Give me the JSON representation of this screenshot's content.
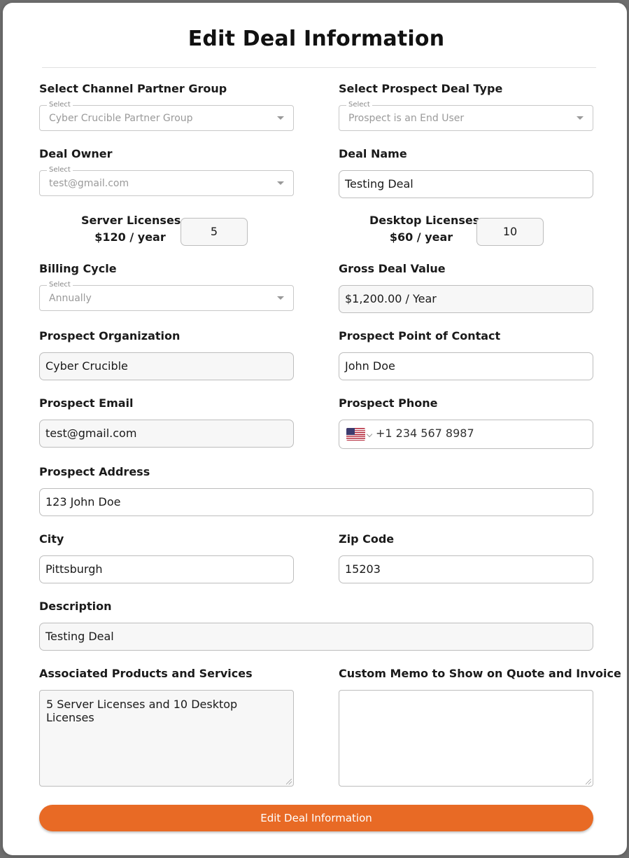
{
  "form": {
    "title": "Edit Deal Information",
    "fields": {
      "channel_partner_group": {
        "label": "Select Channel Partner Group",
        "legend": "Select",
        "value": "Cyber Crucible Partner Group"
      },
      "prospect_deal_type": {
        "label": "Select Prospect Deal Type",
        "legend": "Select",
        "value": "Prospect is an End User"
      },
      "deal_owner": {
        "label": "Deal Owner",
        "legend": "Select",
        "value": "test@gmail.com"
      },
      "deal_name": {
        "label": "Deal Name",
        "value": "Testing Deal"
      },
      "server_licenses": {
        "label": "Server Licenses",
        "price": "$120 / year",
        "value": "5"
      },
      "desktop_licenses": {
        "label": "Desktop Licenses",
        "price": "$60 / year",
        "value": "10"
      },
      "billing_cycle": {
        "label": "Billing Cycle",
        "legend": "Select",
        "value": "Annually"
      },
      "gross_deal_value": {
        "label": "Gross Deal Value",
        "value": "$1,200.00 / Year"
      },
      "prospect_organization": {
        "label": "Prospect Organization",
        "value": "Cyber Crucible"
      },
      "prospect_point_of_contact": {
        "label": "Prospect Point of Contact",
        "value": "John Doe"
      },
      "prospect_email": {
        "label": "Prospect Email",
        "value": "test@gmail.com"
      },
      "prospect_phone": {
        "label": "Prospect Phone",
        "value": "+1 234 567 8987"
      },
      "prospect_address": {
        "label": "Prospect Address",
        "value": "123 John Doe"
      },
      "city": {
        "label": "City",
        "value": "Pittsburgh"
      },
      "zip_code": {
        "label": "Zip Code",
        "value": "15203"
      },
      "description": {
        "label": "Description",
        "value": "Testing Deal"
      },
      "associated_products": {
        "label": "Associated Products and Services",
        "value": "5 Server Licenses and 10 Desktop Licenses"
      },
      "custom_memo": {
        "label": "Custom Memo to Show on Quote and Invoice",
        "value": ""
      }
    },
    "submit_label": "Edit Deal Information"
  },
  "colors": {
    "accent": "#e86a25",
    "field_fill": "#f7f7f7",
    "border": "#bdbdbd"
  },
  "icons": {
    "phone_country": "us-flag-icon",
    "dropdown": "caret-down-icon"
  }
}
